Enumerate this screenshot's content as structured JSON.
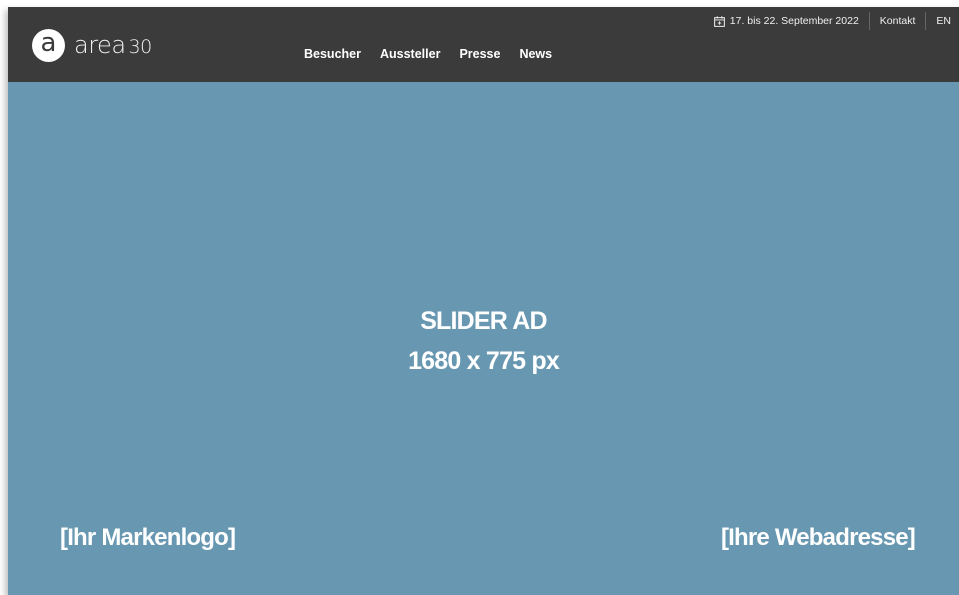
{
  "logo": {
    "mark": "a",
    "name": "area",
    "number": "30"
  },
  "nav": [
    {
      "label": "Besucher"
    },
    {
      "label": "Aussteller"
    },
    {
      "label": "Presse"
    },
    {
      "label": "News"
    }
  ],
  "utility": {
    "date_icon": "calendar-icon",
    "date": "17. bis 22. September 2022",
    "contact": "Kontakt",
    "language": "EN"
  },
  "slider": {
    "title": "SLIDER AD",
    "size": "1680 x 775 px",
    "logo_placeholder": "[Ihr Markenlogo]",
    "web_placeholder": "[Ihre Webadresse]"
  },
  "colors": {
    "header": "#3b3b3b",
    "slider": "#6898b1"
  }
}
